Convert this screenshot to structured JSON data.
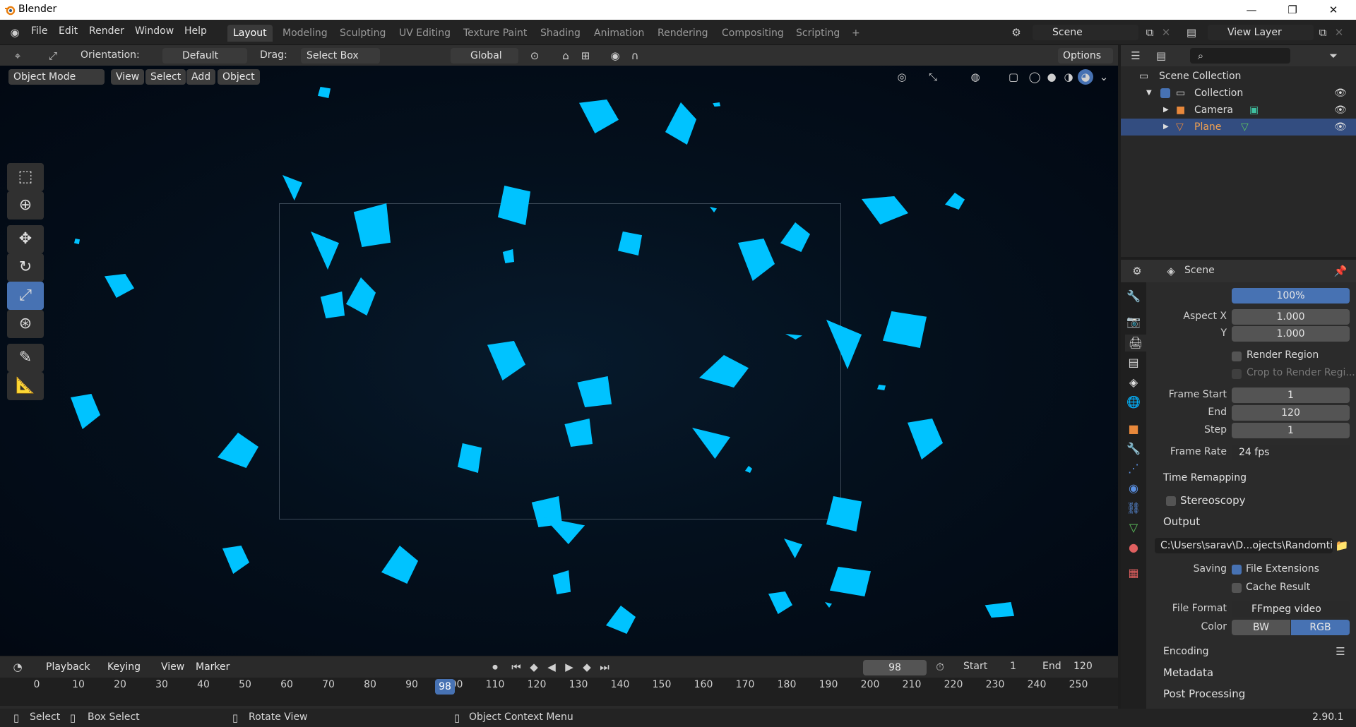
{
  "window": {
    "title": "Blender",
    "minimize": "—",
    "restore": "❐",
    "close": "✕"
  },
  "menu": {
    "file": "File",
    "edit": "Edit",
    "render": "Render",
    "window": "Window",
    "help": "Help"
  },
  "workspaces": [
    "Layout",
    "Modeling",
    "Sculpting",
    "UV Editing",
    "Texture Paint",
    "Shading",
    "Animation",
    "Rendering",
    "Compositing",
    "Scripting"
  ],
  "workspace_add": "+",
  "scene_field": "Scene",
  "view_layer_field": "View Layer",
  "tool_header": {
    "orientation_label": "Orientation:",
    "orientation_value": "Default",
    "drag_label": "Drag:",
    "drag_value": "Select Box",
    "transform_value": "Global",
    "options": "Options"
  },
  "viewport_header": {
    "mode": "Object Mode",
    "view": "View",
    "select": "Select",
    "add": "Add",
    "object": "Object"
  },
  "timeline": {
    "playback": "Playback",
    "keying": "Keying",
    "view": "View",
    "marker": "Marker",
    "current_frame": "98",
    "start_label": "Start",
    "start_value": "1",
    "end_label": "End",
    "end_value": "120",
    "ticks": [
      "0",
      "10",
      "20",
      "30",
      "40",
      "50",
      "60",
      "70",
      "80",
      "90",
      "100",
      "110",
      "120",
      "130",
      "140",
      "150",
      "160",
      "170",
      "180",
      "190",
      "200",
      "210",
      "220",
      "230",
      "240",
      "250"
    ],
    "playhead": "98"
  },
  "status": {
    "select": "Select",
    "box_select": "Box Select",
    "rotate_view": "Rotate View",
    "context_menu": "Object Context Menu",
    "version": "2.90.1"
  },
  "outliner": {
    "scene_collection": "Scene Collection",
    "collection": "Collection",
    "camera": "Camera",
    "plane": "Plane"
  },
  "properties": {
    "context": "Scene",
    "percent_label": "%",
    "percent_value": "100%",
    "aspect_x_label": "Aspect X",
    "aspect_x_value": "1.000",
    "aspect_y_label": "Y",
    "aspect_y_value": "1.000",
    "render_region": "Render Region",
    "crop_region": "Crop to Render Regi...",
    "frame_start_label": "Frame Start",
    "frame_start_value": "1",
    "end_label": "End",
    "end_value": "120",
    "step_label": "Step",
    "step_value": "1",
    "frame_rate_label": "Frame Rate",
    "frame_rate_value": "24 fps",
    "time_remapping": "Time Remapping",
    "stereoscopy": "Stereoscopy",
    "output": "Output",
    "output_path": "C:\\Users\\sarav\\D...ojects\\Randomtile\\",
    "saving_label": "Saving",
    "file_extensions": "File Extensions",
    "cache_result": "Cache Result",
    "file_format_label": "File Format",
    "file_format_value": "FFmpeg video",
    "color_label": "Color",
    "color_bw": "BW",
    "color_rgb": "RGB",
    "encoding": "Encoding",
    "metadata": "Metadata",
    "post_processing": "Post Processing"
  },
  "colors": {
    "accent": "#4772b3",
    "shard": "#00c3ff",
    "background": "#04101d"
  }
}
